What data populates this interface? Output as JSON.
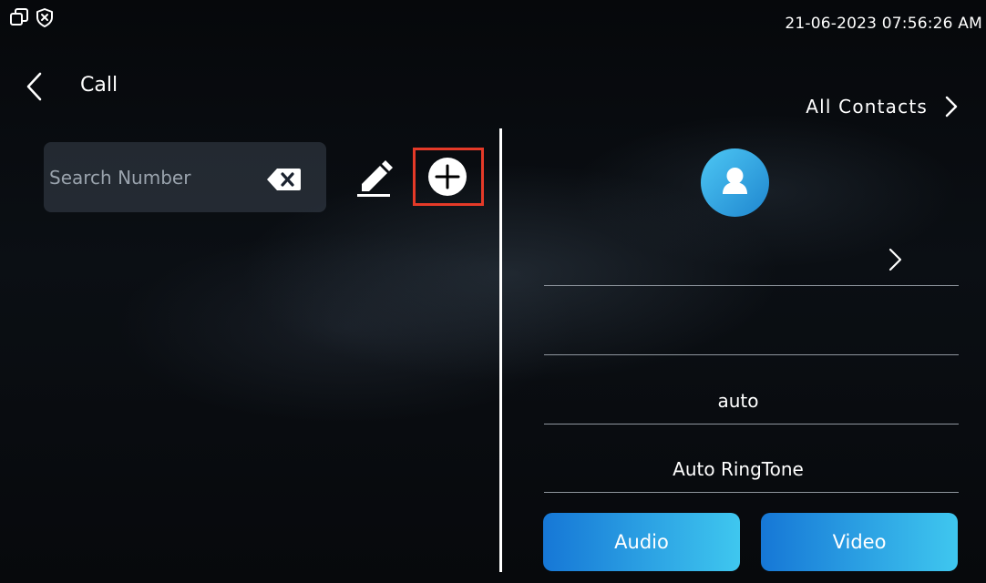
{
  "status_bar": {
    "datetime": "21-06-2023 07:56:26 AM",
    "left_icons": [
      "window-restore-icon",
      "shield-x-icon"
    ]
  },
  "header": {
    "title": "Call",
    "all_contacts_label": "All Contacts"
  },
  "search": {
    "placeholder": "Search Number",
    "value": ""
  },
  "toolbar": {
    "icons": [
      "clear-backspace-icon",
      "edit-pencil-icon",
      "add-circle-icon"
    ],
    "highlight_color": "#e53a28"
  },
  "contact_detail": {
    "ring_mode": "auto",
    "ringtone": "Auto RingTone",
    "audio_label": "Audio",
    "video_label": "Video"
  },
  "colors": {
    "accent_start": "#1677d6",
    "accent_end": "#3fc7ef",
    "avatar": "#2a9de0"
  }
}
